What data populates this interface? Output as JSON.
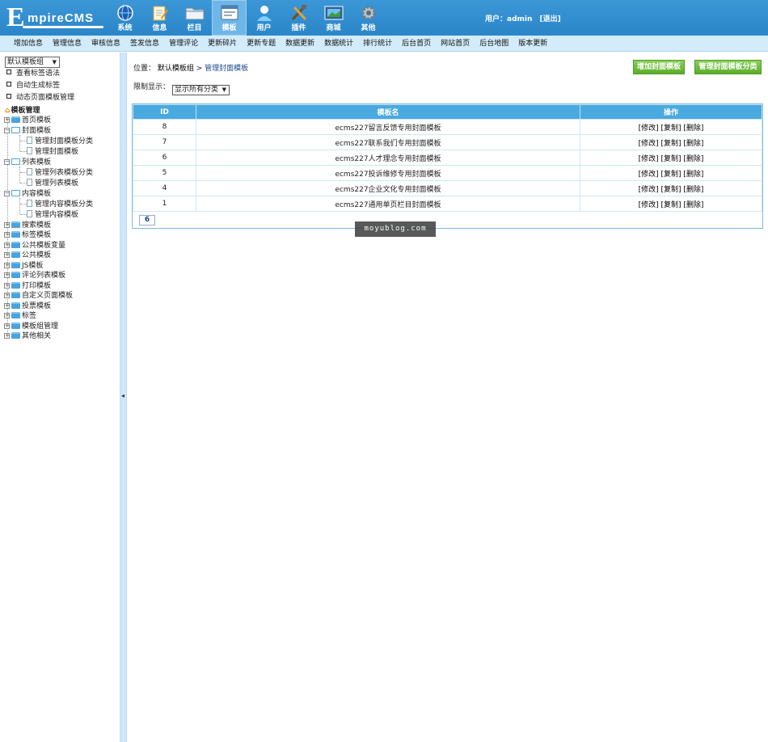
{
  "header": {
    "logo_e": "E",
    "logo_rest": "mpireCMS",
    "nav": [
      {
        "label": "系统",
        "icon": "globe-icon"
      },
      {
        "label": "信息",
        "icon": "edit-icon"
      },
      {
        "label": "栏目",
        "icon": "folder-icon"
      },
      {
        "label": "模板",
        "icon": "template-icon"
      },
      {
        "label": "用户",
        "icon": "user-icon"
      },
      {
        "label": "插件",
        "icon": "tools-icon"
      },
      {
        "label": "商城",
        "icon": "shop-icon"
      },
      {
        "label": "其他",
        "icon": "gear-icon"
      }
    ],
    "active_nav": "模板",
    "user_prefix": "用户：",
    "username": "admin",
    "logout": "[退出]"
  },
  "submenu": [
    "增加信息",
    "管理信息",
    "审核信息",
    "签发信息",
    "管理评论",
    "更新碎片",
    "更新专题",
    "数据更新",
    "数据统计",
    "排行统计",
    "后台首页",
    "网站首页",
    "后台地图",
    "版本更新"
  ],
  "sidebar": {
    "group_select": "默认模板组",
    "links": [
      "查看标签语法",
      "自动生成标签",
      "动态页面模板管理"
    ],
    "tree_title": "模板管理",
    "tree": [
      {
        "label": "首页模板"
      },
      {
        "label": "封面模板",
        "children": [
          "管理封面模板分类",
          "管理封面模板"
        ]
      },
      {
        "label": "列表模板",
        "children": [
          "管理列表模板分类",
          "管理列表模板"
        ]
      },
      {
        "label": "内容模板",
        "children": [
          "管理内容模板分类",
          "管理内容模板"
        ]
      },
      {
        "label": "搜索模板"
      },
      {
        "label": "标签模板"
      },
      {
        "label": "公共模板变量"
      },
      {
        "label": "公共模板"
      },
      {
        "label": "JS模板"
      },
      {
        "label": "评论列表模板"
      },
      {
        "label": "打印模板"
      },
      {
        "label": "自定义页面模板"
      },
      {
        "label": "投票模板"
      },
      {
        "label": "标签"
      },
      {
        "label": "模板组管理"
      },
      {
        "label": "其他相关"
      }
    ]
  },
  "main": {
    "breadcrumb_prefix": "位置：",
    "breadcrumb_parent": "默认模板组",
    "breadcrumb_sep": " > ",
    "breadcrumb_current": "管理封面模板",
    "btn_add": "增加封面模板",
    "btn_manage_class": "管理封面模板分类",
    "filter_label": "限制显示：",
    "filter_value": "显示所有分类",
    "table": {
      "headers": [
        "ID",
        "模板名",
        "操作"
      ],
      "rows": [
        {
          "id": "8",
          "name": "ecms227留言反馈专用封面模板"
        },
        {
          "id": "7",
          "name": "ecms227联系我们专用封面模板"
        },
        {
          "id": "6",
          "name": "ecms227人才理念专用封面模板"
        },
        {
          "id": "5",
          "name": "ecms227投诉维修专用封面模板"
        },
        {
          "id": "4",
          "name": "ecms227企业文化专用封面模板"
        },
        {
          "id": "1",
          "name": "ecms227通用单页栏目封面模板"
        }
      ],
      "actions": [
        "[修改]",
        "[复制]",
        "[删除]"
      ]
    },
    "pager": "6"
  },
  "watermark": "moyublog.com",
  "colors": {
    "header_blue": "#2b86c9",
    "submenu_bg": "#d3ebfa",
    "table_head": "#4aa9de",
    "button_green": "#5cac2a"
  }
}
